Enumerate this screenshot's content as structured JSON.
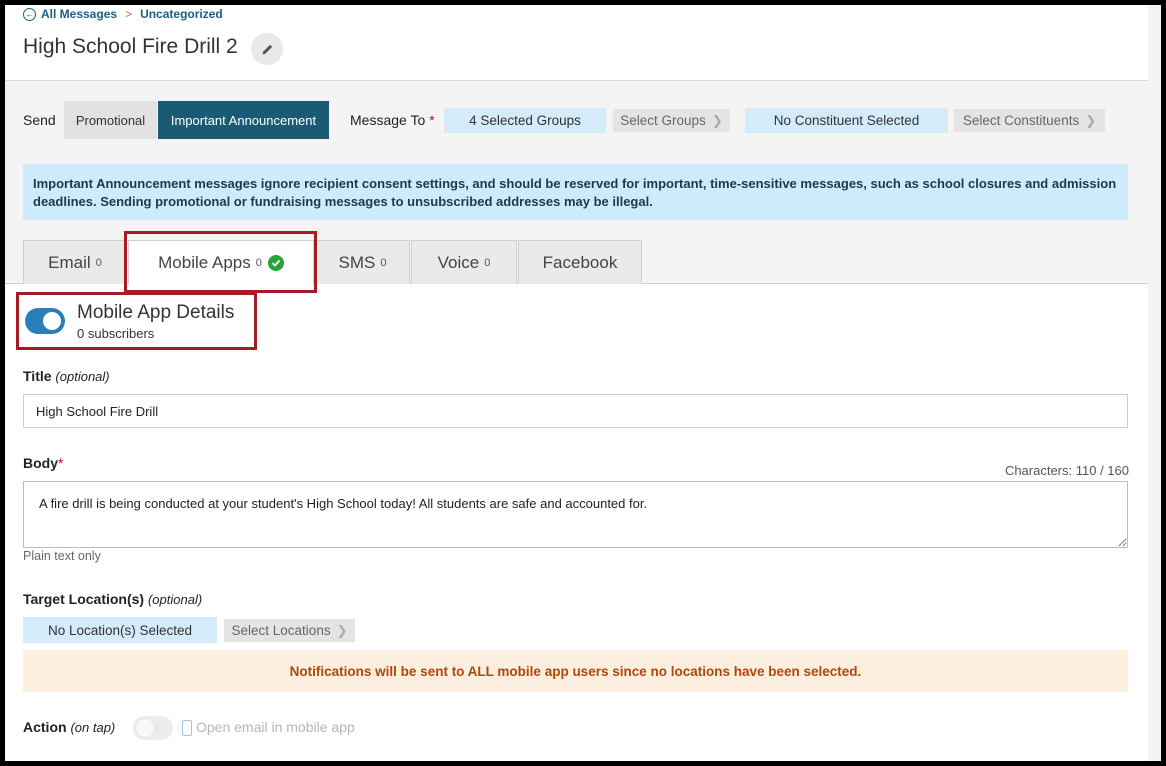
{
  "breadcrumb": {
    "all_messages": "All Messages",
    "separator": ">",
    "category": "Uncategorized"
  },
  "header": {
    "title": "High School Fire Drill 2"
  },
  "send": {
    "label": "Send",
    "options": [
      "Promotional",
      "Important Announcement"
    ],
    "selected": "Important Announcement"
  },
  "message_to": {
    "label": "Message To",
    "required_mark": "*",
    "groups_selected": "4 Selected Groups",
    "select_groups": "Select Groups",
    "constituents_selected": "No Constituent Selected",
    "select_constituents": "Select Constituents"
  },
  "info_banner": "Important Announcement messages ignore recipient consent settings, and should be reserved for important, time-sensitive messages, such as school closures and admission deadlines. Sending promotional or fundraising messages to unsubscribed addresses may be illegal.",
  "tabs": [
    {
      "label": "Email",
      "count": "0"
    },
    {
      "label": "Mobile Apps",
      "count": "0",
      "active": true,
      "complete": true
    },
    {
      "label": "SMS",
      "count": "0"
    },
    {
      "label": "Voice",
      "count": "0"
    },
    {
      "label": "Facebook",
      "count": ""
    }
  ],
  "mobile_app": {
    "enabled": true,
    "heading": "Mobile App Details",
    "subscribers": "0 subscribers"
  },
  "title_field": {
    "label": "Title",
    "optional": "(optional)",
    "value": "High School Fire Drill"
  },
  "body_field": {
    "label": "Body",
    "required_mark": "*",
    "char_count": "Characters: 110 / 160",
    "value": "A fire drill is being conducted at your student's High School today! All students are safe and accounted for.",
    "note": "Plain text only"
  },
  "target_location": {
    "label": "Target Location(s)",
    "optional": "(optional)",
    "selected": "No Location(s) Selected",
    "select_button": "Select Locations"
  },
  "warning_banner": "Notifications will be sent to ALL mobile app users since no locations have been selected.",
  "action": {
    "label": "Action",
    "qualifier": "(on tap)",
    "enabled": false,
    "option_label": "Open email in mobile app"
  },
  "colors": {
    "accent": "#1b5a75",
    "toggle_on": "#2a7fb8",
    "info_bg": "#cdebfa",
    "warning_bg": "#fdefe0",
    "warning_text": "#b0470b",
    "highlight_box": "#a51c24",
    "success": "#2aa33b"
  },
  "icons": [
    "back-arrow-icon",
    "pencil-icon",
    "chevron-right-icon",
    "checkmark-circle-icon",
    "mobile-phone-icon"
  ]
}
